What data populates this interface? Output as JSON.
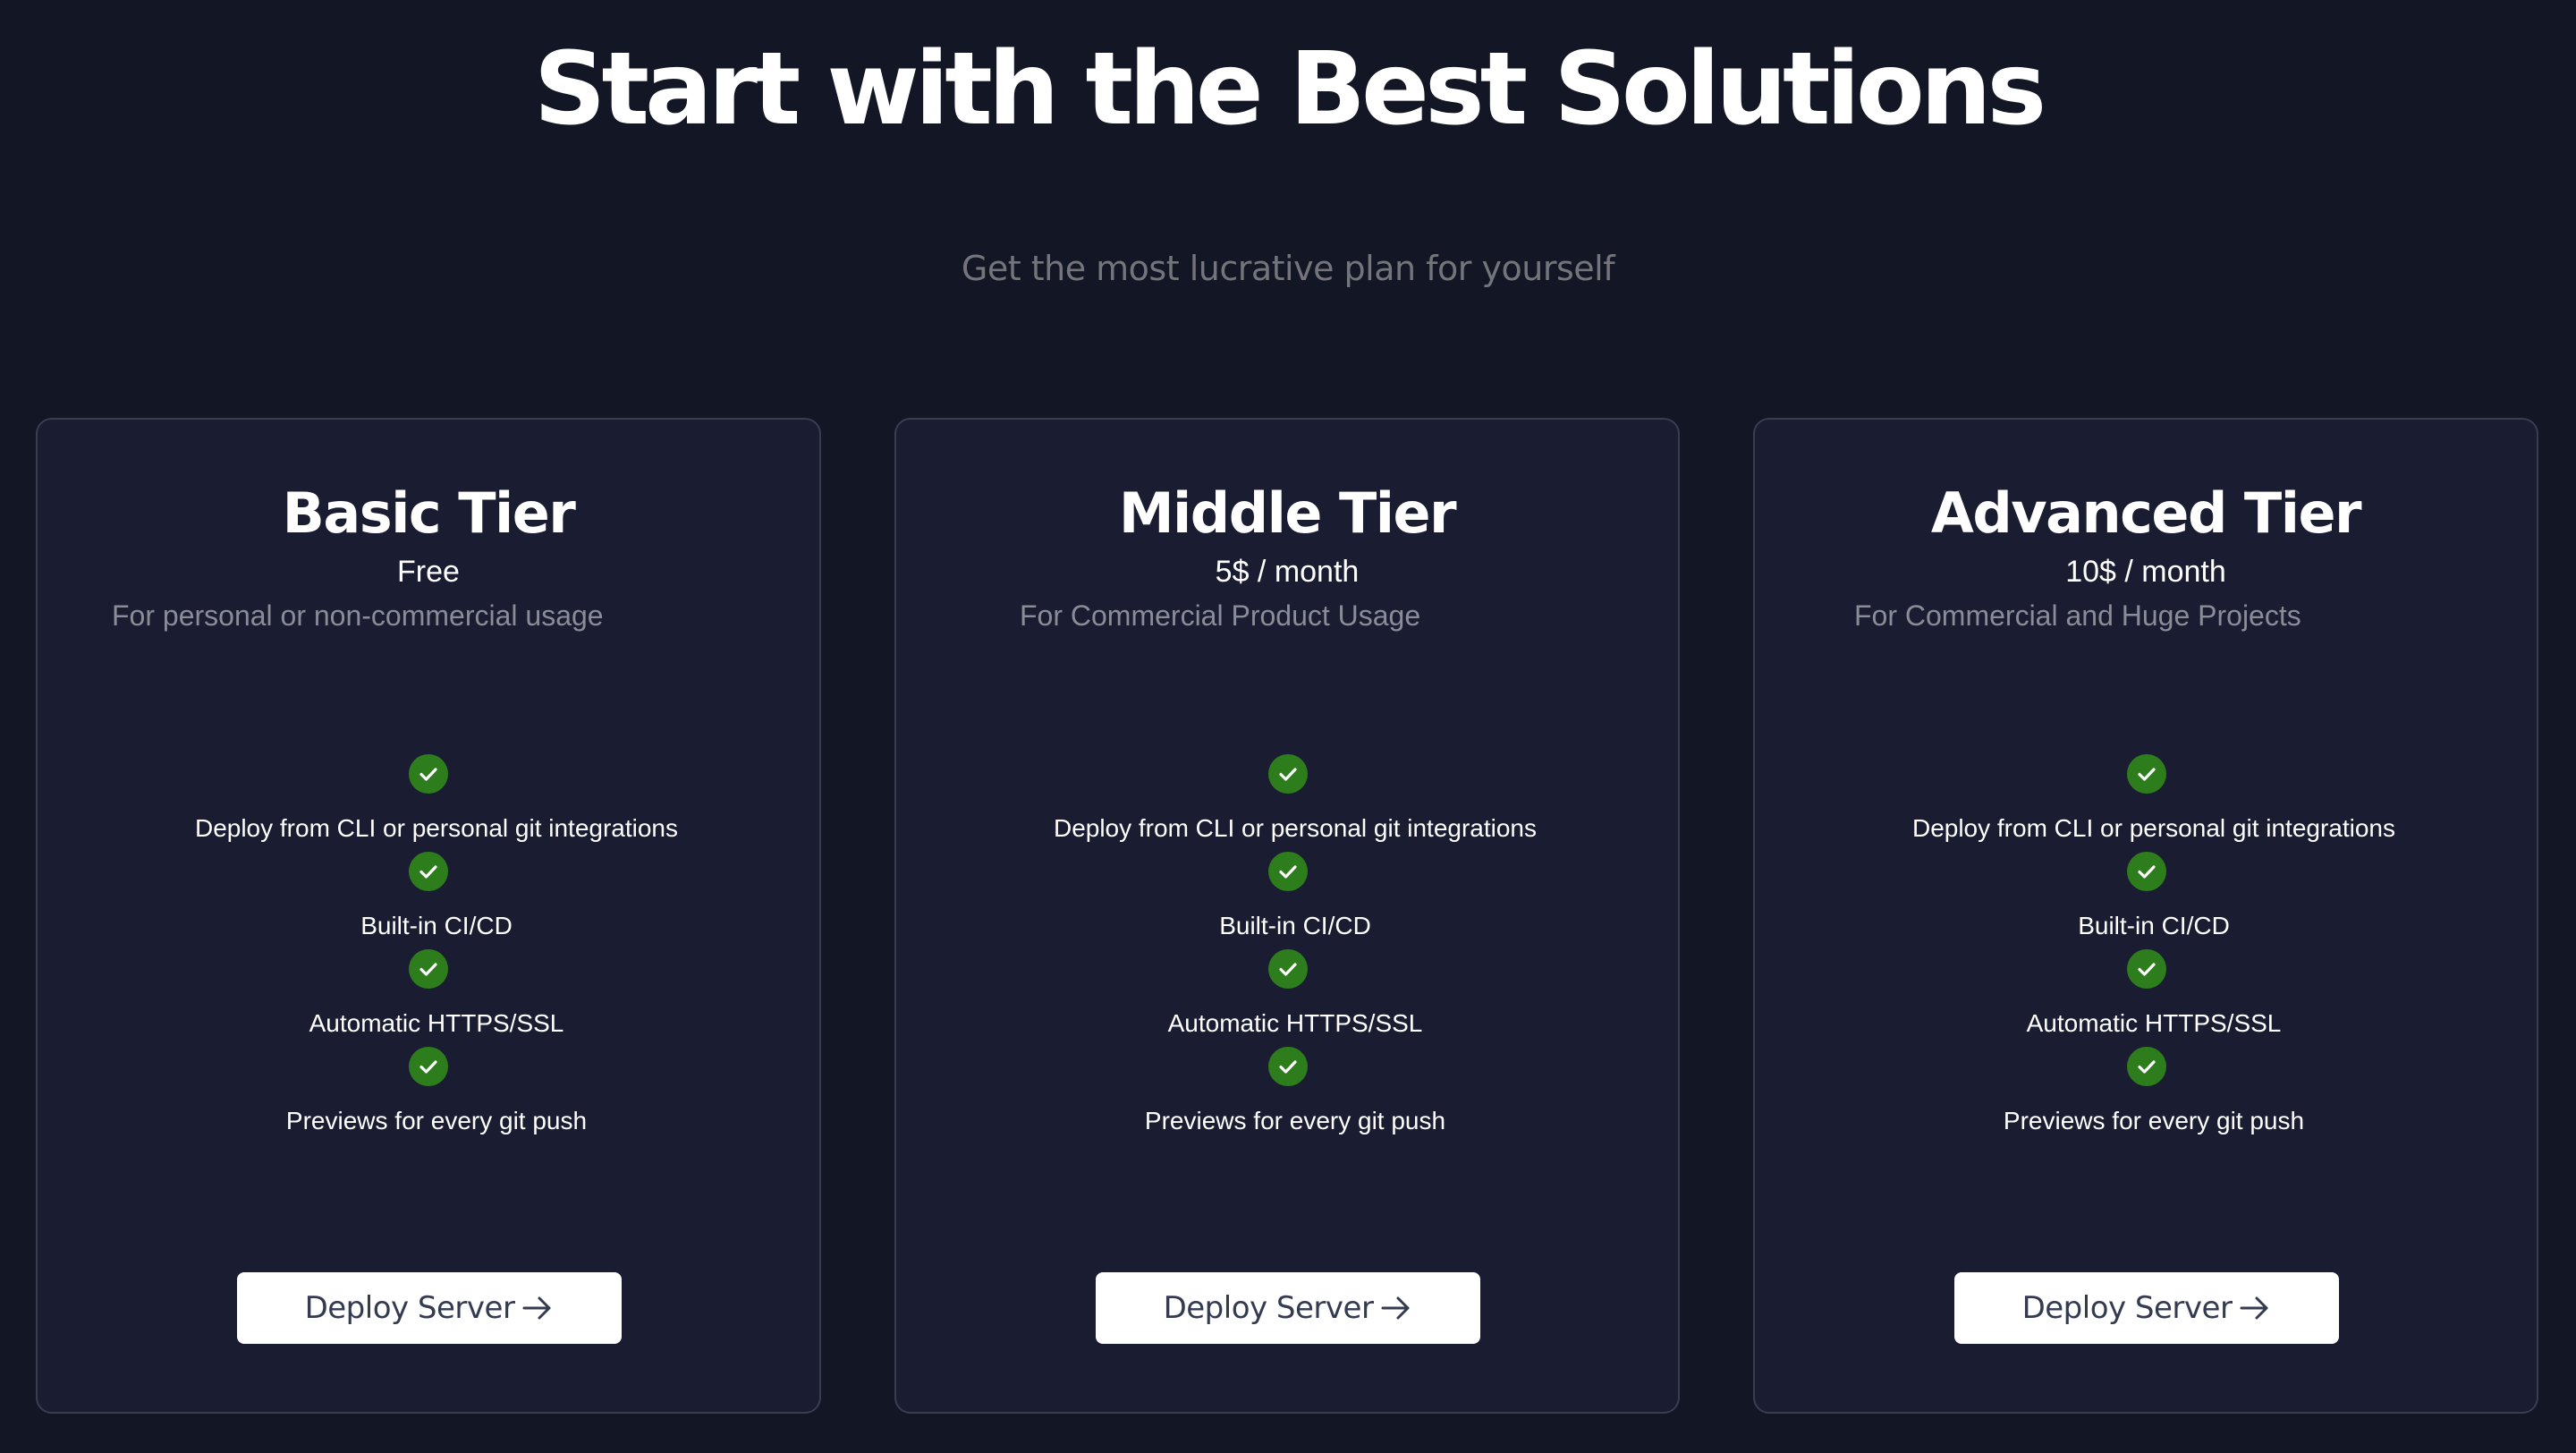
{
  "page": {
    "headline": "Start with the Best Solutions",
    "subtitle": "Get the most lucrative plan for yourself"
  },
  "plans": [
    {
      "title": "Basic Tier",
      "price": "Free",
      "usage": "For personal or non-commercial usage",
      "features": [
        "Deploy from CLI or personal git integrations",
        "Built-in CI/CD",
        "Automatic HTTPS/SSL",
        "Previews for every git push"
      ],
      "button_label": "Deploy Server",
      "button_icon": "arrow-right-icon"
    },
    {
      "title": "Middle Tier",
      "price": "5$ / month",
      "usage": "For Commercial Product Usage",
      "features": [
        "Deploy from CLI or personal git integrations",
        "Built-in CI/CD",
        "Automatic HTTPS/SSL",
        "Previews for every git push"
      ],
      "button_label": "Deploy Server",
      "button_icon": "arrow-right-icon"
    },
    {
      "title": "Advanced Tier",
      "price": "10$ / month",
      "usage": "For Commercial and Huge Projects",
      "features": [
        "Deploy from CLI or personal git integrations",
        "Built-in CI/CD",
        "Automatic HTTPS/SSL",
        "Previews for every git push"
      ],
      "button_label": "Deploy Server",
      "button_icon": "arrow-right-icon"
    }
  ],
  "colors": {
    "background": "#131624",
    "card_background": "#1a1c31",
    "card_border": "#3a3d52",
    "check_green": "#2e7d1c",
    "muted_text": "#8a8c98",
    "button_background": "#ffffff",
    "button_text": "#343a50"
  },
  "icons": {
    "feature_check": "check-circle-icon"
  }
}
